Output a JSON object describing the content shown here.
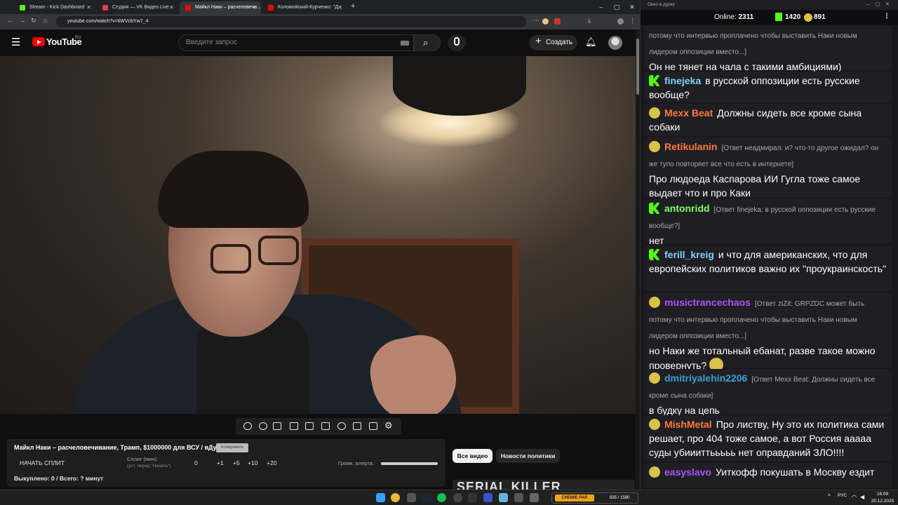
{
  "browser": {
    "tabs": [
      {
        "title": "Stream - Kick Dashboard",
        "color": "#53fc18"
      },
      {
        "title": "Студия — VK Видео Live",
        "color": "#e23c5a"
      },
      {
        "title": "Майкл Наки – расчеловечи...",
        "color": "#ff0000"
      },
      {
        "title": "Коломойский-Курченко: \"Д...",
        "color": "#ff0000"
      }
    ],
    "url": "youtube.com/watch?v=tiWVcbYw7_4",
    "window_controls": [
      "–",
      "▢",
      "✕"
    ]
  },
  "youtube": {
    "logo_text": "YouTube",
    "logo_region": "RU",
    "search_placeholder": "Введите запрос",
    "create_label": "Создать",
    "video_title": "Майкл Наки – расчеловечивание, Трамп, $1000000 для ВСУ / вДудь",
    "chips": [
      "Все видео",
      "Новости политики"
    ],
    "thumbnail_text": "SERIAL KILLER"
  },
  "extension": {
    "copy_label": "Копировать",
    "start_split": "НАЧАТЬ СПЛИТ",
    "split_label": "Сплит (мин):",
    "split_sub": "(уст. перед \"Начать\")",
    "split_values": [
      "0",
      "+1",
      "+5",
      "+10",
      "+20"
    ],
    "alert_label": "Громк. алерта:",
    "alert_volume_fraction": 1.0,
    "bought": "Выкуплено: 0 / Всего: ? минут"
  },
  "chat": {
    "window_title": "Окно в дурку",
    "online_label": "Online:",
    "online_value": "2311",
    "kick_value": "1420",
    "other_value": "891",
    "messages": [
      {
        "icon": "none",
        "user": "",
        "user_color": "#fff",
        "reply": "потому что интервью проплачено чтобы выставить Наки новым лидером оппозиции вместо...]",
        "text": "Он не тянет на чала с такими амбициями)"
      },
      {
        "icon": "kick",
        "user": "finejeka",
        "user_color": "#7dd3fc",
        "reply": "",
        "text": "в русской оппозиции есть русские вообще?"
      },
      {
        "icon": "pepe",
        "user": "Mexx Beat",
        "user_color": "#ff7a3d",
        "reply": "",
        "text": "Должны сидеть все кроме сына собаки"
      },
      {
        "icon": "pepe",
        "user": "Retikulanin",
        "user_color": "#ff7a3d",
        "reply": "[Ответ неадмирал: и? что-то другое ожидал? он же тупо повторяет все что есть в интернете]",
        "text": "Про людоеда Каспарова ИИ Гугла тоже самое выдает что  и про Каки"
      },
      {
        "icon": "kick",
        "user": "antonridd",
        "user_color": "#7cfc6a",
        "reply": "[Ответ finejeka: в русской оппозиции есть русские вообще?]",
        "text": "нет"
      },
      {
        "icon": "kick",
        "user": "ferill_kreig",
        "user_color": "#7dd3fc",
        "reply": "",
        "text": "и что для американских, что для европейских политиков важно их \"проукраинскость\""
      },
      {
        "icon": "pepe",
        "user": "musictrancechaos",
        "user_color": "#a855f7",
        "reply": "[Ответ ziZit: GRPZDC может быть потому что интервью проплачено чтобы выставить Наки новым лидером оппозиции вместо...]",
        "text": "но Наки же тотальный ебанат, разве такое можно провернуть?"
      },
      {
        "icon": "pepe",
        "user": "dmitriyalehin2206",
        "user_color": "#3b9fd6",
        "reply": "[Ответ Mexx Beat: Должны сидеть все кроме сына собаки]",
        "text": "в будку на цепь"
      },
      {
        "icon": "pepe",
        "user": "MishMetal",
        "user_color": "#ff7a3d",
        "reply": "",
        "text": "Про листву, Ну это их политика сами решает, про 404 тоже самое, а вот Россия ааааа суды убиииттььььь нет оправданий ЗЛО!!!!"
      },
      {
        "icon": "pepe",
        "user": "easyslavo",
        "user_color": "#a855f7",
        "reply": "",
        "text": "Уиткофф покушать в Москву ездит"
      }
    ]
  },
  "taskbar": {
    "game_logo": "CHEMIE PAR",
    "game_count": "835 / 1590",
    "lang": "РУС",
    "time": "16:09",
    "date": "20.12.2025"
  }
}
